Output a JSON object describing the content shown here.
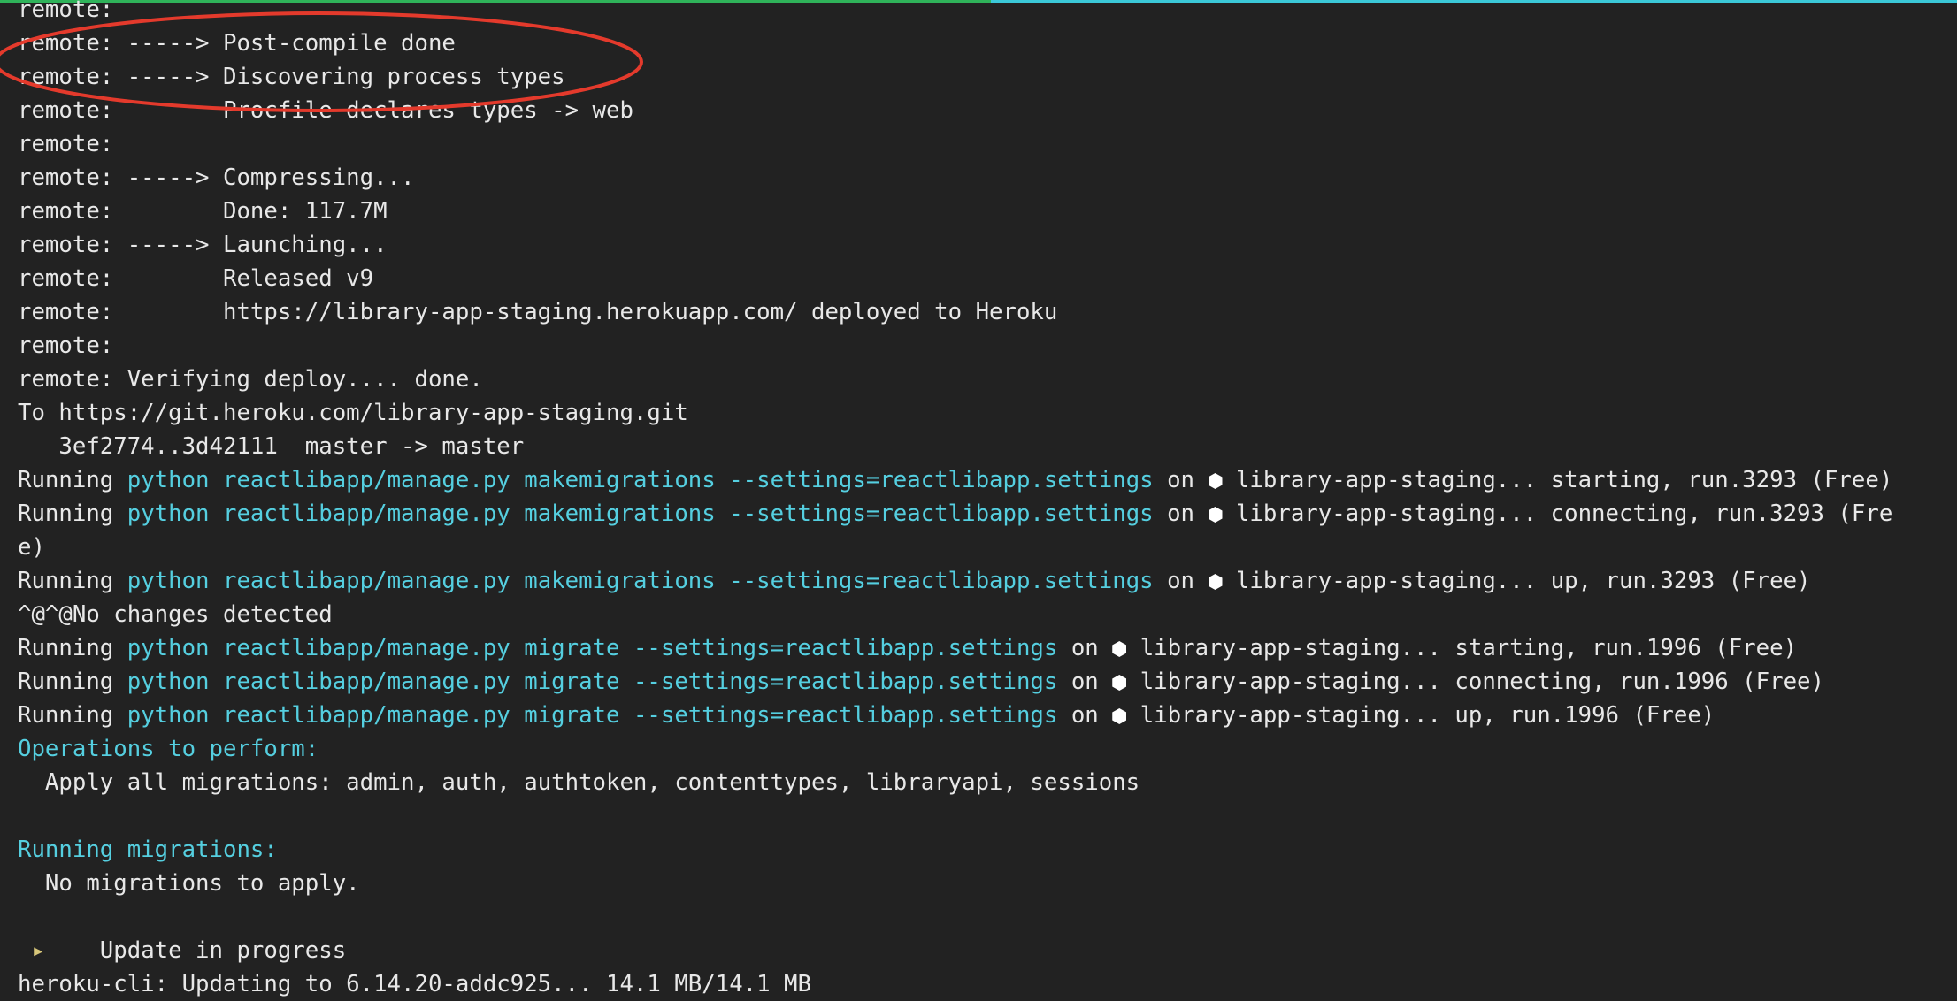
{
  "colors": {
    "background": "#222222",
    "text": "#e8e8e8",
    "command": "#55cfe0",
    "annotation": "#e43a2c",
    "progress_done": "#2fb35a",
    "progress_rest": "#3bc8d8",
    "arrow_indicator": "#d8c77a"
  },
  "annotation": {
    "shape": "ellipse",
    "color": "#e43a2c"
  },
  "lines": {
    "l0": "remote:",
    "l1": "remote: -----> Post-compile done",
    "l2": "remote: -----> Discovering process types",
    "l3": "remote:        Procfile declares types -> web",
    "l4": "remote:",
    "l5": "remote: -----> Compressing...",
    "l6": "remote:        Done: 117.7M",
    "l7": "remote: -----> Launching...",
    "l8": "remote:        Released v9",
    "l9": "remote:        https://library-app-staging.herokuapp.com/ deployed to Heroku",
    "l10": "remote:",
    "l11": "remote: Verifying deploy.... done.",
    "l12": "To https://git.heroku.com/library-app-staging.git",
    "l13": "   3ef2774..3d42111  master -> master",
    "l14": {
      "prefix": "Running ",
      "cmd": "python reactlibapp/manage.py makemigrations --settings=reactlibapp.settings",
      "on": " on ",
      "status": " library-app-staging... starting, run.3293 (Free)"
    },
    "l15": {
      "prefix": "Running ",
      "cmd": "python reactlibapp/manage.py makemigrations --settings=reactlibapp.settings",
      "on": " on ",
      "status": " library-app-staging... connecting, run.3293 (Fre"
    },
    "l16": "e)",
    "l17": {
      "prefix": "Running ",
      "cmd": "python reactlibapp/manage.py makemigrations --settings=reactlibapp.settings",
      "on": " on ",
      "status": " library-app-staging... up, run.3293 (Free)"
    },
    "l18": "^@^@No changes detected",
    "l19": {
      "prefix": "Running ",
      "cmd": "python reactlibapp/manage.py migrate --settings=reactlibapp.settings",
      "on": " on ",
      "status": " library-app-staging... starting, run.1996 (Free)"
    },
    "l20": {
      "prefix": "Running ",
      "cmd": "python reactlibapp/manage.py migrate --settings=reactlibapp.settings",
      "on": " on ",
      "status": " library-app-staging... connecting, run.1996 (Free)"
    },
    "l21": {
      "prefix": "Running ",
      "cmd": "python reactlibapp/manage.py migrate --settings=reactlibapp.settings",
      "on": " on ",
      "status": " library-app-staging... up, run.1996 (Free)"
    },
    "l22": "Operations to perform:",
    "l23": "  Apply all migrations: admin, auth, authtoken, contenttypes, libraryapi, sessions",
    "l24": "",
    "l25": "Running migrations:",
    "l26": "  No migrations to apply.",
    "l27": "",
    "l28": {
      "arrow": " ▸",
      "text": "    Update in progress"
    },
    "l29": "heroku-cli: Updating to 6.14.20-addc925... 14.1 MB/14.1 MB"
  }
}
